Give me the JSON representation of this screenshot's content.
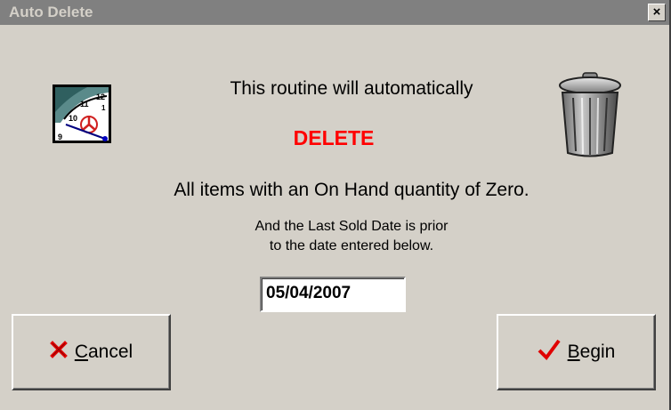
{
  "window": {
    "title": "Auto Delete",
    "close_glyph": "×"
  },
  "message": {
    "line1": "This routine will automatically",
    "action": "DELETE",
    "action_color": "#ff0000",
    "line3": "All items with an On Hand quantity of Zero.",
    "line4a": "And the Last Sold Date is prior",
    "line4b": "to the date entered below."
  },
  "date_field": {
    "value": "05/04/2007"
  },
  "buttons": {
    "cancel": {
      "mnemonic": "C",
      "rest": "ancel",
      "icon": "red-x-icon"
    },
    "begin": {
      "mnemonic": "B",
      "rest": "egin",
      "icon": "red-checkmark-icon"
    }
  },
  "icons": {
    "left": "clock-icon",
    "right": "trash-can-icon"
  }
}
